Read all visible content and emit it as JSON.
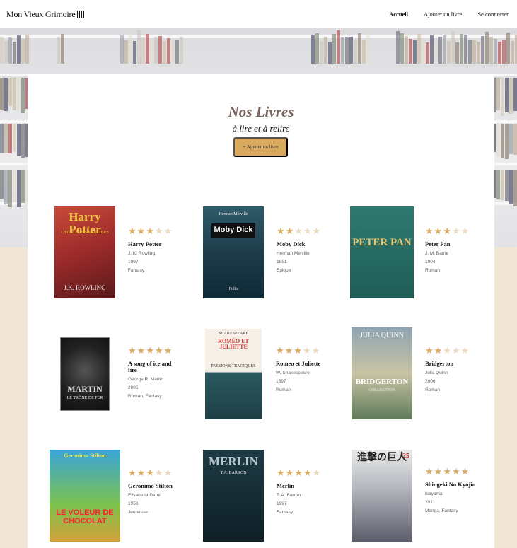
{
  "header": {
    "logo": "Mon Vieux Grimoire",
    "nav": [
      "Accueil",
      "Ajouter un livre",
      "Se connecter"
    ]
  },
  "main": {
    "title": "Nos Livres",
    "subtitle": "à lire et à relire",
    "add_button": "+ Ajouter un livre"
  },
  "colors": {
    "accent": "#d9a95f",
    "title": "#7a6460",
    "page_bg": "#f2e6d6"
  },
  "books": [
    {
      "title": "Harry Potter",
      "author": "J. K. Rowling.",
      "year": "1997",
      "genre": "Fantasy",
      "rating": 3,
      "cover": {
        "main": "Harry Potter",
        "sub": "L'ÉCOLE DES SORCIERS",
        "foot": "J.K. ROWLING"
      }
    },
    {
      "title": "Moby Dick",
      "author": "Herman Melville",
      "year": "1851",
      "genre": "Epique",
      "rating": 2,
      "cover": {
        "main": "Moby Dick",
        "sub": "Herman Melville",
        "foot": "Folio"
      }
    },
    {
      "title": "Peter Pan",
      "author": "J. M. Barrie",
      "year": "1904",
      "genre": "Roman",
      "rating": 3,
      "cover": {
        "main": "PETER PAN",
        "sub": "",
        "foot": ""
      }
    },
    {
      "title": "A song of ice and fire",
      "author": "George R. Martin",
      "year": "2005",
      "genre": "Roman, Fantasy",
      "rating": 5,
      "cover": {
        "main": "MARTIN",
        "sub": "LE TRÔNE DE FER",
        "foot": ""
      }
    },
    {
      "title": "Romeo et Juliette",
      "author": "W. Shakespeare",
      "year": "1597",
      "genre": "Roman",
      "rating": 3,
      "cover": {
        "main": "ROMÉO ET JULIETTE",
        "sub": "SHAKESPEARE",
        "foot": "PASSIONS TRAGIQUES"
      }
    },
    {
      "title": "Bridgerton",
      "author": "Julia Quinn",
      "year": "2006",
      "genre": "Roman",
      "rating": 2,
      "cover": {
        "main": "BRIDGERTON",
        "sub": "JULIA QUINN",
        "foot": "COLLECTION"
      }
    },
    {
      "title": "Geronimo Stilton",
      "author": "Elisabetta Dami",
      "year": "1958",
      "genre": "Jeunesse",
      "rating": 3,
      "cover": {
        "main": "LE VOLEUR DE CHOCOLAT",
        "sub": "Geronimo Stilton",
        "foot": ""
      }
    },
    {
      "title": "Merlin",
      "author": "T. A. Barron",
      "year": "1997",
      "genre": "Fantasy",
      "rating": 4,
      "cover": {
        "main": "MERLIN",
        "sub": "T.A. BARRON",
        "foot": ""
      }
    },
    {
      "title": "Shingeki No Kyojin",
      "author": "Isayama",
      "year": "2011",
      "genre": "Manga, Fantasy",
      "rating": 5,
      "cover": {
        "main": "進撃の巨人",
        "sub": "25",
        "foot": ""
      }
    }
  ]
}
